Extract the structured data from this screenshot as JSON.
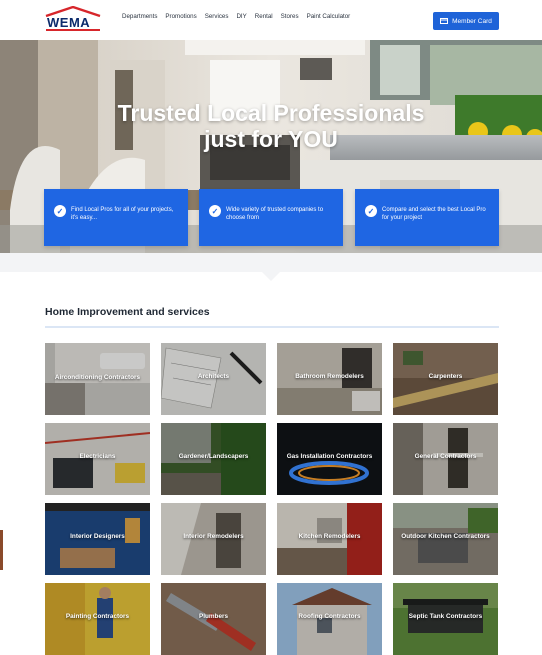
{
  "header": {
    "logo_text": "WEMA",
    "nav": [
      "Departments",
      "Promotions",
      "Services",
      "DIY",
      "Rental",
      "Stores",
      "Paint Calculator"
    ],
    "member_button": "Member Card"
  },
  "hero": {
    "title_line1": "Trusted Local Professionals",
    "title_line2": "just for YOU"
  },
  "features": [
    "Find Local Pros for all of your projects, it's easy...",
    "Wide variety of trusted companies to choose from",
    "Compare and select the best Local Pro for your project"
  ],
  "section": {
    "title": "Home Improvement and services"
  },
  "services": [
    "Airconditioning Contractors",
    "Architects",
    "Bathroom Remodelers",
    "Carpenters",
    "Electricians",
    "Gardener/Landscapers",
    "Gas Installation Contractors",
    "General Contractors",
    "Interior Designers",
    "Interior Remodelers",
    "Kitchen Remodelers",
    "Outdoor Kitchen Contractors",
    "Painting Contractors",
    "Plumbers",
    "Roofing Contractors",
    "Septic Tank Contractors"
  ],
  "colors": {
    "brand_blue": "#1f66e3",
    "logo_red": "#d7262b",
    "logo_navy": "#0b2a6b"
  },
  "icons": {
    "member_button": "card-icon",
    "feature_check": "check-circle-icon"
  }
}
